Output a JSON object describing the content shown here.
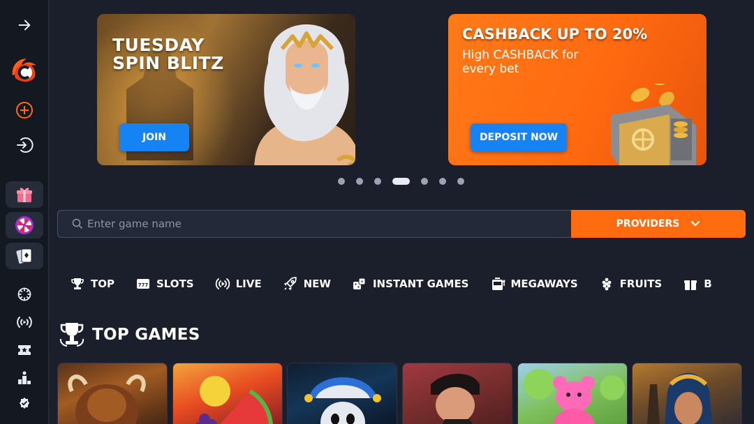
{
  "sidebar": {
    "items": [
      {
        "name": "collapse-arrow"
      },
      {
        "name": "logo"
      },
      {
        "name": "register"
      },
      {
        "name": "login"
      },
      {
        "name": "gift"
      },
      {
        "name": "wheel"
      },
      {
        "name": "cards"
      },
      {
        "name": "casino"
      },
      {
        "name": "live"
      },
      {
        "name": "tickets"
      },
      {
        "name": "leaderboard"
      },
      {
        "name": "badge"
      }
    ]
  },
  "banners": [
    {
      "title": "TUESDAY SPIN BLITZ",
      "subtitle": "",
      "cta": "JOIN"
    },
    {
      "title": "CASHBACK UP TO 20%",
      "subtitle": "High CASHBACK for every bet",
      "cta": "DEPOSIT NOW"
    }
  ],
  "carousel": {
    "count": 7,
    "active_index": 3
  },
  "search": {
    "placeholder": "Enter game name",
    "value": ""
  },
  "providers_label": "PROVIDERS",
  "categories": [
    {
      "label": "TOP",
      "icon": "trophy-icon"
    },
    {
      "label": "SLOTS",
      "icon": "slot-777-icon"
    },
    {
      "label": "LIVE",
      "icon": "live-broadcast-icon"
    },
    {
      "label": "NEW",
      "icon": "rocket-icon"
    },
    {
      "label": "INSTANT GAMES",
      "icon": "dice-icon"
    },
    {
      "label": "MEGAWAYS",
      "icon": "slot-machine-icon"
    },
    {
      "label": "FRUITS",
      "icon": "fruit-icon"
    },
    {
      "label": "B",
      "icon": "gift-box-icon"
    }
  ],
  "section": {
    "title": "TOP GAMES",
    "icon": "trophy-icon"
  },
  "colors": {
    "background": "#1a1f2b",
    "sidebar": "#141821",
    "accent_orange": "#ff6b0e",
    "accent_blue": "#1683f5"
  }
}
